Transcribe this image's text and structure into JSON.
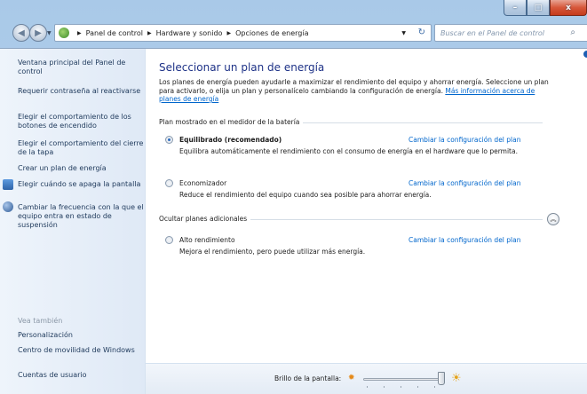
{
  "window": {
    "caption": {
      "minimize": "–",
      "maximize": "□",
      "close": "x"
    }
  },
  "navbar": {
    "back": "◀",
    "forward": "▶",
    "breadcrumb": [
      "Panel de control",
      "Hardware y sonido",
      "Opciones de energía"
    ],
    "separator": "▶",
    "dropdown": "▼",
    "refresh": "↻",
    "search_placeholder": "Buscar en el Panel de control",
    "search_icon": "⌕"
  },
  "sidebar": {
    "links": [
      "Ventana principal del Panel de control",
      "Requerir contraseña al reactivarse",
      "Elegir el comportamiento de los botones de encendido",
      "Elegir el comportamiento del cierre de la tapa",
      "Crear un plan de energía",
      "Elegir cuándo se apaga la pantalla",
      "Cambiar la frecuencia con la que el equipo entra en estado de suspensión"
    ],
    "see_also_heading": "Vea también",
    "see_also": [
      "Personalización",
      "Centro de movilidad de Windows",
      "Cuentas de usuario"
    ]
  },
  "main": {
    "title": "Seleccionar un plan de energía",
    "intro": "Los planes de energía pueden ayudarle a maximizar el rendimiento del equipo y ahorrar energía. Seleccione un plan para activarlo, o elija un plan y personalícelo cambiando la configuración de energía.",
    "intro_link": "Más información acerca de planes de energía",
    "group_battery": "Plan mostrado en el medidor de la batería",
    "group_hidden": "Ocultar planes adicionales",
    "change_link": "Cambiar la configuración del plan",
    "plans": [
      {
        "name": "Equilibrado (recomendado)",
        "description": "Equilibra automáticamente el rendimiento con el consumo de energía en el hardware que lo permita.",
        "selected": true
      },
      {
        "name": "Economizador",
        "description": "Reduce el rendimiento del equipo cuando sea posible para ahorrar energía.",
        "selected": false
      },
      {
        "name": "Alto rendimiento",
        "description": "Mejora el rendimiento, pero puede utilizar más energía.",
        "selected": false
      }
    ],
    "collapse_glyph": "︽"
  },
  "brightness": {
    "label": "Brillo de la pantalla:",
    "level": 1.0,
    "sun_small": "✹",
    "sun_big": "☀"
  }
}
